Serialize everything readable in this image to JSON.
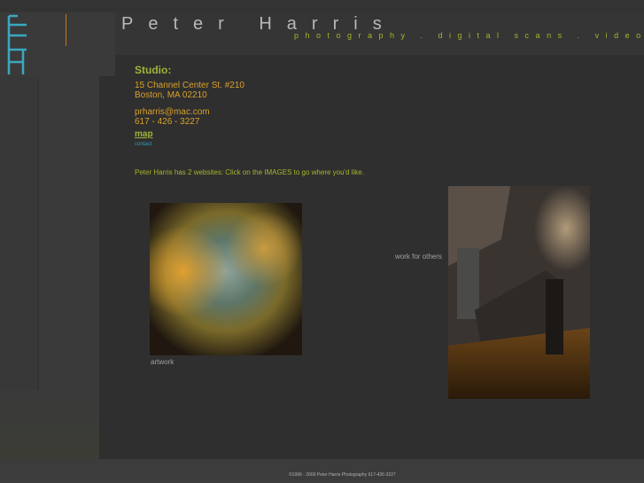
{
  "header": {
    "title": "Peter Harris",
    "subtitle": "photography . digital scans . videos"
  },
  "studio": {
    "heading": "Studio:",
    "address_line1": "15 Channel Center St.  #210",
    "address_line2": "Boston, MA  02210",
    "email": "prharris@mac.com",
    "phone": "617 - 426 - 3227",
    "map_label": "map",
    "contact_label": "contact"
  },
  "intro": "Peter Harris has 2 websites: Click on the IMAGES to go where you'd like.",
  "sites": {
    "artwork_label": "artwork",
    "others_label": "work for others"
  },
  "footer": {
    "copyright": "©1996 - 2009 Peter Harris Photography 617-426-3227"
  },
  "colors": {
    "accent_green": "#a0b43a",
    "accent_orange": "#d8a12a",
    "accent_cyan": "#2aa0b0",
    "background": "#2f2f2f"
  }
}
